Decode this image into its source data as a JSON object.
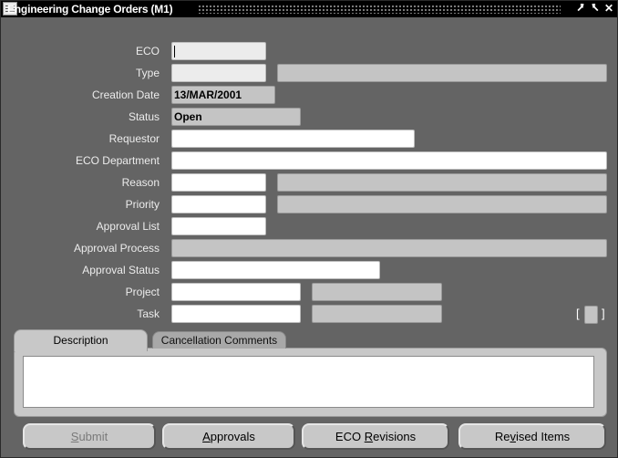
{
  "window": {
    "title": "Engineering Change Orders (M1)",
    "controls": [
      "minimize",
      "maximize",
      "close"
    ]
  },
  "form": {
    "eco_label": "ECO",
    "eco_value": "",
    "type_label": "Type",
    "creation_date_label": "Creation Date",
    "creation_date_value": "13/MAR/2001",
    "status_label": "Status",
    "status_value": "Open",
    "requestor_label": "Requestor",
    "eco_department_label": "ECO Department",
    "reason_label": "Reason",
    "priority_label": "Priority",
    "approval_list_label": "Approval List",
    "approval_process_label": "Approval Process",
    "approval_status_label": "Approval Status",
    "project_label": "Project",
    "task_label": "Task",
    "flex_open": "[",
    "flex_close": "]"
  },
  "tabs": {
    "description": "Description",
    "cancellation_comments": "Cancellation Comments"
  },
  "buttons": {
    "submit": {
      "pre": "",
      "u": "S",
      "post": "ubmit"
    },
    "approvals": {
      "pre": "",
      "u": "A",
      "post": "pprovals"
    },
    "eco_revisions": {
      "pre": "ECO ",
      "u": "R",
      "post": "evisions"
    },
    "revised_items": {
      "pre": "Re",
      "u": "v",
      "post": "ised Items"
    }
  }
}
